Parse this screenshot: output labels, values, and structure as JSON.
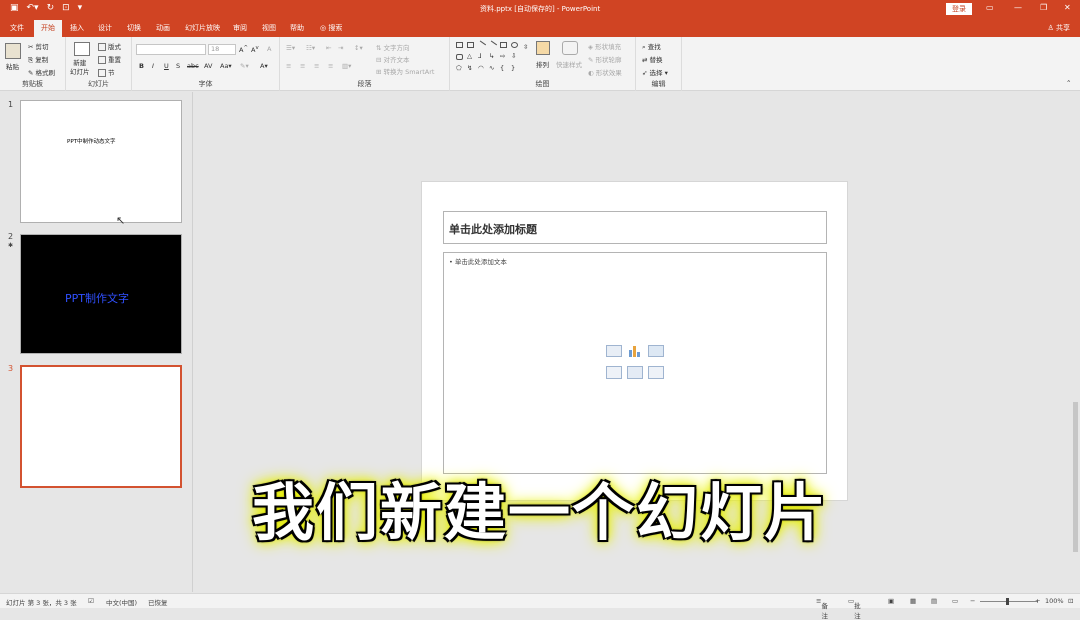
{
  "titlebar": {
    "doc_title": "资料.pptx [自动保存的]  -  PowerPoint",
    "login": "登录"
  },
  "tabs": [
    "文件",
    "开始",
    "插入",
    "设计",
    "切换",
    "动画",
    "幻灯片放映",
    "审阅",
    "视图",
    "帮助"
  ],
  "tell_me": "搜索",
  "share": "共享",
  "ribbon": {
    "clipboard": {
      "label": "剪贴板",
      "paste": "粘贴",
      "cut": "剪切",
      "copy": "复制",
      "format_painter": "格式刷"
    },
    "slides": {
      "label": "幻灯片",
      "new_slide": "新建\n幻灯片",
      "layout": "版式",
      "reset": "重置",
      "section": "节"
    },
    "font": {
      "label": "字体",
      "font_size": "18"
    },
    "paragraph": {
      "label": "段落",
      "text_direction": "文字方向",
      "align_text": "对齐文本",
      "smartart": "转换为 SmartArt"
    },
    "drawing": {
      "label": "绘图",
      "arrange": "排列",
      "quick_styles": "快速样式",
      "shape_fill": "形状填充",
      "shape_outline": "形状轮廓",
      "shape_effects": "形状效果"
    },
    "editing": {
      "label": "编辑",
      "find": "查找",
      "replace": "替换",
      "select": "选择"
    }
  },
  "slides": [
    {
      "num": "1",
      "text": "PPT中制作动态文字"
    },
    {
      "num": "2",
      "text": "PPT制作文字"
    },
    {
      "num": "3",
      "text": ""
    }
  ],
  "slide": {
    "title_placeholder": "单击此处添加标题",
    "content_placeholder": "单击此处添加文本"
  },
  "status": {
    "slide_info": "幻灯片 第 3 张，共 3 张",
    "language": "中文(中国)",
    "recovered": "已恢复",
    "notes": "备注",
    "comments": "批注",
    "zoom": "100%"
  },
  "caption": "我们新建一个幻灯片",
  "colors": {
    "accent": "#d04423",
    "selection": "#d35230",
    "caption_glow": "#e8f000"
  }
}
